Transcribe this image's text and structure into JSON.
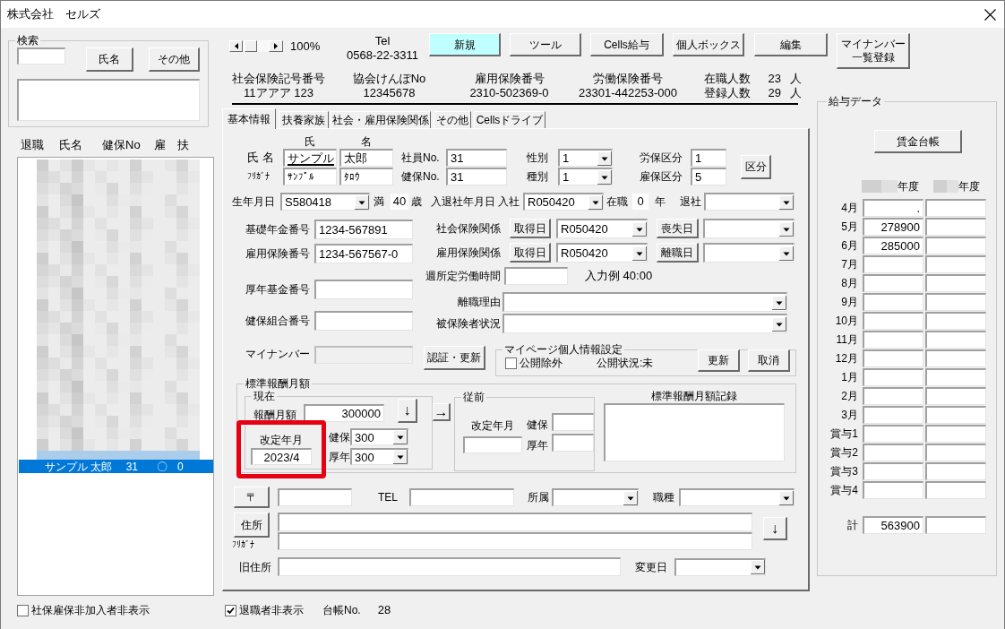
{
  "window": {
    "title": "株式会社　セルズ"
  },
  "search": {
    "title": "検索",
    "buttons": [
      "氏名",
      "その他"
    ]
  },
  "employee_list": {
    "columns": [
      "退職",
      "氏名",
      "健保No",
      "雇",
      "扶"
    ],
    "rows": [
      {
        "name": "サンプル 太郎",
        "health_no": "31",
        "employment_insurance": "〇",
        "dependents": "0",
        "selected": true
      }
    ]
  },
  "hide_uninsured": {
    "label": "社保雇保非加入者非表示",
    "checked": false
  },
  "zoom": "100%",
  "tel": {
    "label": "Tel",
    "number": "0568-22-3311"
  },
  "toolbar": [
    {
      "label": "新規",
      "highlighted": true
    },
    {
      "label": "ツール",
      "highlighted": false
    },
    {
      "label": "Cells給与",
      "highlighted": false
    },
    {
      "label": "個人ボックス",
      "highlighted": false
    },
    {
      "label": "編集",
      "highlighted": false
    },
    {
      "label": "マイナンバー一覧登録",
      "highlighted": false
    }
  ],
  "company_numbers": [
    {
      "label": "社会保険記号番号",
      "value": "11アアア 123"
    },
    {
      "label": "協会けんぽNo",
      "value": "12345678"
    },
    {
      "label": "雇用保険番号",
      "value": "2310-502369-0"
    },
    {
      "label": "労働保険番号",
      "value": "23301-442253-000"
    }
  ],
  "headcounts": [
    {
      "label": "在職人数",
      "value": "23",
      "unit": "人"
    },
    {
      "label": "登録人数",
      "value": "29",
      "unit": "人"
    }
  ],
  "tabs": [
    {
      "label": "基本情報",
      "selected": true
    },
    {
      "label": "扶養家族",
      "selected": false
    },
    {
      "label": "社会・雇用保険関係",
      "selected": false
    },
    {
      "label": "その他",
      "selected": false
    },
    {
      "label": "Cellsドライブ",
      "selected": false
    }
  ],
  "basic_info": {
    "name_columns": [
      "氏",
      "名"
    ],
    "name": {
      "label": "氏 名",
      "family": "サンプル",
      "given": "太郎"
    },
    "kana": {
      "label": "ﾌﾘｶﾞﾅ",
      "family": "ｻﾝﾌﾟﾙ",
      "given": "ﾀﾛｳ"
    },
    "employee_no": {
      "label": "社員No.",
      "value": "31"
    },
    "health_no": {
      "label": "健保No.",
      "value": "31"
    },
    "gender": {
      "label": "性別",
      "value": "1"
    },
    "category": {
      "label": "種別",
      "value": "1"
    },
    "labor_insurance_class": {
      "label": "労保区分",
      "value": "1"
    },
    "employment_insurance_class": {
      "label": "雇保区分",
      "value": "5"
    },
    "class_button": "区分",
    "birth_date": {
      "label": "生年月日",
      "value": "S580418"
    },
    "age": {
      "prefix": "満",
      "value": "40",
      "unit": "歳"
    },
    "employment_dates_label": "入退社年月日",
    "hire": {
      "label": "入社",
      "value": "R050420"
    },
    "tenure": {
      "label": "在職",
      "value": "0",
      "unit": "年"
    },
    "leave": {
      "label": "退社"
    },
    "pension_no": {
      "label": "基礎年金番号",
      "value": "1234-567891"
    },
    "employment_insurance_no": {
      "label": "雇用保険番号",
      "value": "1234-567567-0"
    },
    "pension_fund_no": {
      "label": "厚年基金番号"
    },
    "health_union_no": {
      "label": "健保組合番号"
    },
    "social_insurance": {
      "label": "社会保険関係",
      "acquire_button": "取得日",
      "acquire_date": "R050420",
      "loss_button": "喪失日"
    },
    "employment_insurance": {
      "label": "雇用保険関係",
      "acquire_button": "取得日",
      "acquire_date": "R050420",
      "loss_button": "離職日"
    },
    "weekly_hours": {
      "label": "週所定労働時間",
      "hint": "入力例 40:00"
    },
    "leave_reason": {
      "label": "離職理由"
    },
    "insured_status": {
      "label": "被保険者状況"
    },
    "my_number": {
      "label": "マイナンバー",
      "disabled": true
    },
    "auth_button": "認証・更新",
    "mypage": {
      "title": "マイページ個人情報設定",
      "exclude": {
        "label": "公開除外",
        "checked": false
      },
      "status": "公開状況:未",
      "buttons": [
        "更新",
        "取消"
      ]
    },
    "standard_remuneration": {
      "title": "標準報酬月額",
      "current": {
        "title": "現在",
        "monthly_label": "報酬月額",
        "monthly": "300000",
        "down_button": "↓",
        "revision_label": "改定年月",
        "revision": "2023/4",
        "revision_highlighted": true,
        "health_label": "健保",
        "health": "300",
        "pension_label": "厚年",
        "pension": "300"
      },
      "copy_button": "→",
      "previous": {
        "title": "従前",
        "revision_label": "改定年月",
        "health_label": "健保",
        "pension_label": "厚年"
      },
      "history_label": "標準報酬月額記録"
    },
    "postal_button": "〒",
    "tel_label": "TEL",
    "department": {
      "label": "所属"
    },
    "job_type": {
      "label": "職種"
    },
    "address_button": "住所",
    "address_kana_label": "ﾌﾘｶﾞﾅ",
    "address_down_button": "↓",
    "old_address_label": "旧住所",
    "change_date_label": "変更日"
  },
  "hide_retired": {
    "label": "退職者非表示",
    "checked": true
  },
  "ledger_no": {
    "label": "台帳No.",
    "value": "28"
  },
  "salary_data": {
    "title": "給与データ",
    "ledger_button": "賃金台帳",
    "year_headers": [
      "年度",
      "年度"
    ],
    "rows": [
      {
        "label": "4月",
        "values": [
          "."
        ]
      },
      {
        "label": "5月",
        "values": [
          "278900"
        ]
      },
      {
        "label": "6月",
        "values": [
          "285000"
        ]
      },
      {
        "label": "7月"
      },
      {
        "label": "8月"
      },
      {
        "label": "9月"
      },
      {
        "label": "10月"
      },
      {
        "label": "11月"
      },
      {
        "label": "12月"
      },
      {
        "label": "1月"
      },
      {
        "label": "2月"
      },
      {
        "label": "3月"
      },
      {
        "label": "賞与1"
      },
      {
        "label": "賞与2"
      },
      {
        "label": "賞与3"
      },
      {
        "label": "賞与4"
      }
    ],
    "total": {
      "label": "計",
      "values": [
        "563900"
      ]
    }
  }
}
